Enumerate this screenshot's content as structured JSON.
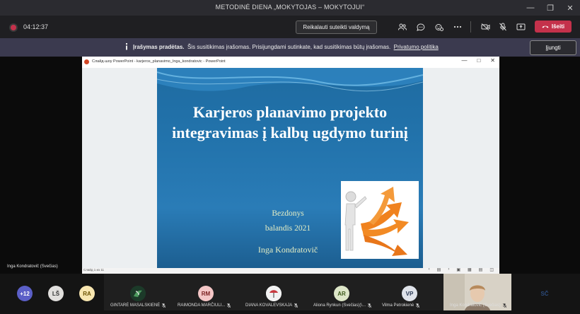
{
  "window": {
    "title": "METODINĖ DIENA „MOKYTOJAS – MOKYTOJUI“"
  },
  "toolbar": {
    "timer": "04:12:37",
    "request_control_label": "Reikalauti suteikti valdymą",
    "leave_label": "Išeiti"
  },
  "banner": {
    "bold": "Įrašymas pradėtas.",
    "text": "Šis susitikimas įrašomas. Prisijungdami sutinkate, kad susitikimas būtų įrašomas.",
    "link": "Privatumo politika",
    "join_label": "Įjungti"
  },
  "stage": {
    "speaker_name": "Inga Kondratovič (Svečias)"
  },
  "ppt": {
    "window_title": "Слайд-шоу PowerPoint  -  karjeros_planavimo_Inga_kondratovic  -  PowerPoint",
    "status": "Слайд 1 из 11"
  },
  "slide": {
    "title": "Karjeros planavimo projekto integravimas į kalbų ugdymo turinį",
    "line1": "Bezdonys",
    "line2": "balandis 2021",
    "author": "Inga Kondratovič"
  },
  "participants": [
    {
      "initials": "+12",
      "bg": "#5b5fc7",
      "fg": "#ffffff"
    },
    {
      "initials": "LŠ",
      "bg": "#e1dfdd",
      "fg": "#333333"
    },
    {
      "initials": "RA",
      "bg": "#f8e6b0",
      "fg": "#6b5200"
    },
    {
      "name": "GINTARĖ MASALSKIENĖ"
    },
    {
      "initials": "RM",
      "bg": "#f4c6c6",
      "fg": "#7a1f1f",
      "name": "RAIMONDA MARČIULI..."
    },
    {
      "name": "DIANA KOVALEVSKAJA"
    },
    {
      "initials": "AR",
      "bg": "#dde6c8",
      "fg": "#3c5a1a",
      "name": "Aliona Rynkun (Svečias)(\\..."
    },
    {
      "initials": "VP",
      "bg": "#dfe3ea",
      "fg": "#2b3a55",
      "name": "Vilma Petrokienė"
    },
    {
      "name": "Inga Kondratovič (Svečias)"
    },
    {
      "initials": "SČ",
      "bg": "#dde6f2",
      "fg": "#2b4a7a"
    }
  ]
}
